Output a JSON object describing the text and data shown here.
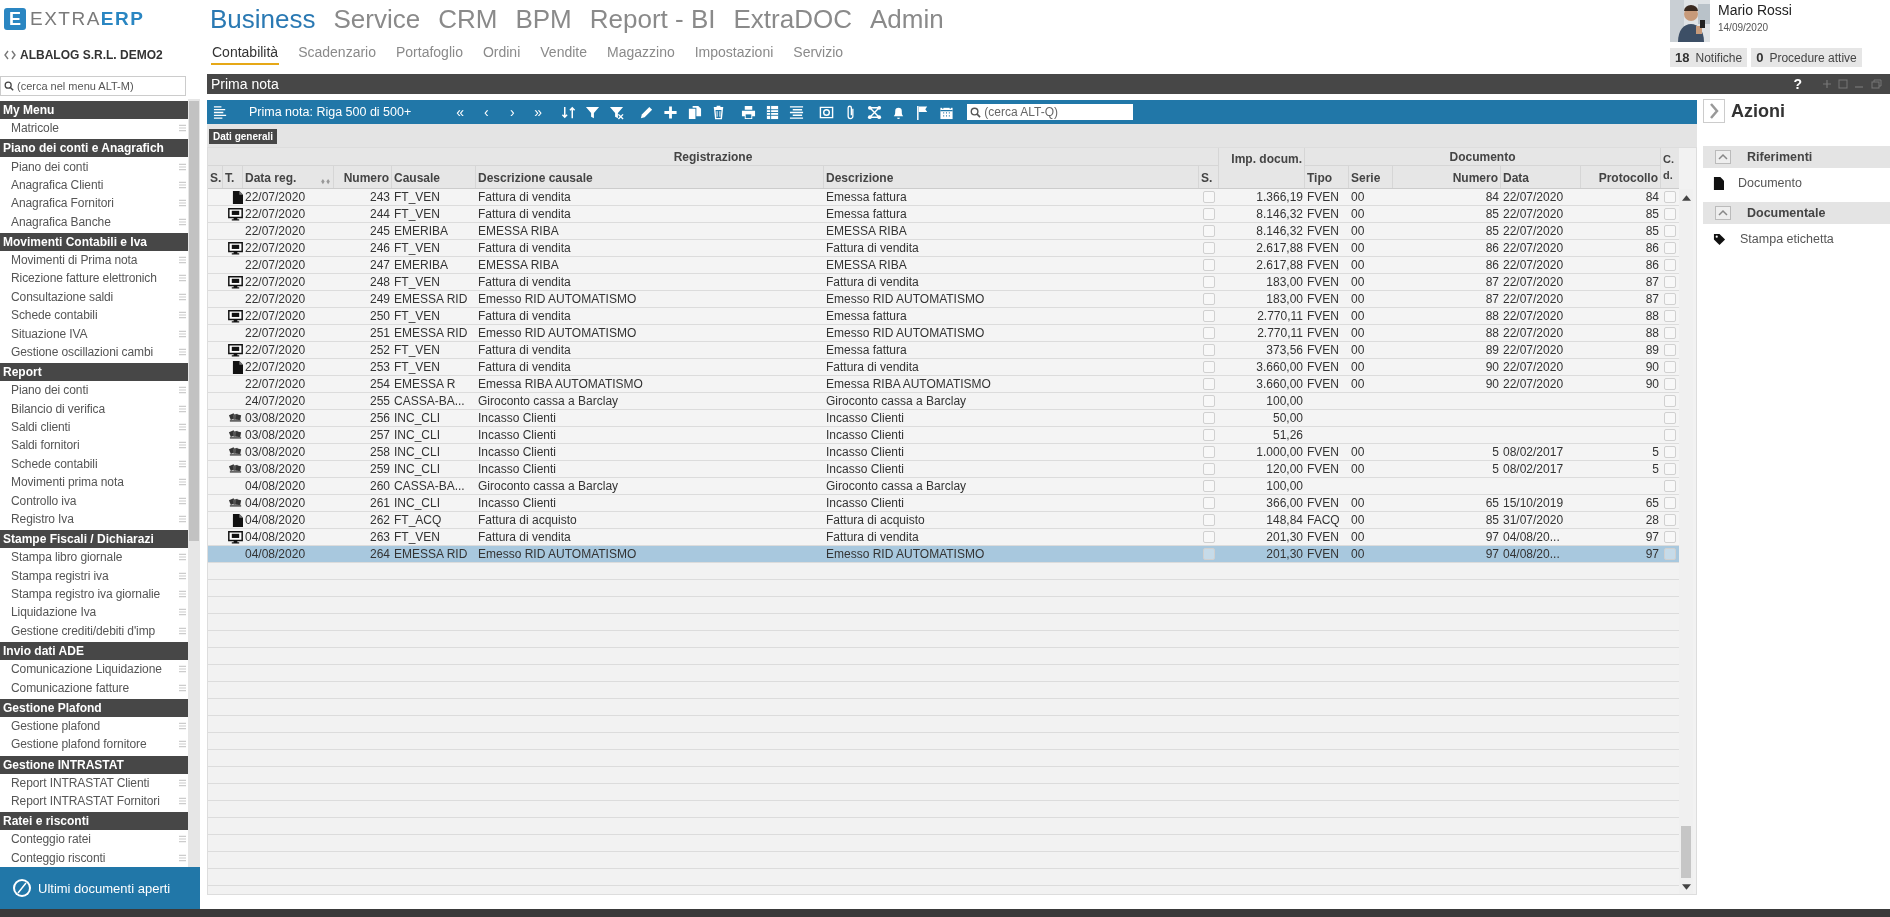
{
  "logo": {
    "badge": "E",
    "text": "EXTRA",
    "accent": "ERP"
  },
  "company": "ALBALOG S.R.L. DEMO2",
  "modules": [
    {
      "label": "Business",
      "selected": true
    },
    {
      "label": "Service",
      "selected": false
    },
    {
      "label": "CRM",
      "selected": false
    },
    {
      "label": "BPM",
      "selected": false
    },
    {
      "label": "Report - BI",
      "selected": false
    },
    {
      "label": "ExtraDOC",
      "selected": false
    },
    {
      "label": "Admin",
      "selected": false
    }
  ],
  "sections": [
    {
      "label": "Contabilità",
      "selected": true
    },
    {
      "label": "Scadenzario",
      "selected": false
    },
    {
      "label": "Portafoglio",
      "selected": false
    },
    {
      "label": "Ordini",
      "selected": false
    },
    {
      "label": "Vendite",
      "selected": false
    },
    {
      "label": "Magazzino",
      "selected": false
    },
    {
      "label": "Impostazioni",
      "selected": false
    },
    {
      "label": "Servizio",
      "selected": false
    }
  ],
  "user": {
    "name": "Mario Rossi",
    "date": "14/09/2020"
  },
  "counters": [
    {
      "count": "18",
      "label": "Notifiche"
    },
    {
      "count": "0",
      "label": "Procedure attive"
    }
  ],
  "menu_search": {
    "placeholder": "(cerca nel menu ALT-M)"
  },
  "menu": [
    {
      "title": "My Menu",
      "items": [
        "Matricole"
      ]
    },
    {
      "title": "Piano dei conti e Anagrafich",
      "items": [
        "Piano dei conti",
        "Anagrafica Clienti",
        "Anagrafica Fornitori",
        "Anagrafica Banche"
      ]
    },
    {
      "title": "Movimenti Contabili e Iva",
      "items": [
        "Movimenti di Prima nota",
        "Ricezione fatture elettronich",
        "Consultazione saldi",
        "Schede contabili",
        "Situazione IVA",
        "Gestione oscillazioni cambi"
      ]
    },
    {
      "title": "Report",
      "items": [
        "Piano dei conti",
        "Bilancio di verifica",
        "Saldi clienti",
        "Saldi fornitori",
        "Schede contabili",
        "Movimenti prima nota",
        "Controllo iva",
        "Registro Iva"
      ]
    },
    {
      "title": "Stampe Fiscali / Dichiarazi",
      "items": [
        "Stampa libro giornale",
        "Stampa registri iva",
        "Stampa registro iva giornalie",
        "Liquidazione Iva",
        "Gestione crediti/debiti d'imp"
      ]
    },
    {
      "title": "Invio dati ADE",
      "items": [
        "Comunicazione Liquidazione",
        "Comunicazione fatture"
      ]
    },
    {
      "title": "Gestione Plafond",
      "items": [
        "Gestione plafond",
        "Gestione plafond fornitore"
      ]
    },
    {
      "title": "Gestione INTRASTAT",
      "items": [
        "Report INTRASTAT Clienti",
        "Report INTRASTAT Fornitori"
      ]
    },
    {
      "title": "Ratei e risconti",
      "items": [
        "Conteggio ratei",
        "Conteggio risconti"
      ]
    }
  ],
  "recent_button": "Ultimi documenti aperti",
  "window": {
    "title": "Prima nota",
    "help": "?"
  },
  "toolbar": {
    "title": "Prima nota: Riga 500 di 500+",
    "nav": [
      "«",
      "‹",
      "›",
      "»"
    ],
    "search": {
      "placeholder": "(cerca ALT-Q)"
    }
  },
  "tabs": [
    {
      "label": "Dati generali",
      "selected": true
    }
  ],
  "table": {
    "header": [
      {
        "group": "Registrazione",
        "columns": [
          "S.",
          "T.",
          "Data reg.",
          "Numero",
          "Causale",
          "Descrizione causale",
          "Descrizione",
          "S."
        ]
      },
      {
        "column": "Imp. docum."
      },
      {
        "group": "Documento",
        "columns": [
          "Tipo",
          "Serie",
          "Numero",
          "Data",
          "Protocollo"
        ]
      },
      {
        "column": "C. d."
      }
    ],
    "rows": [
      {
        "kind": "document",
        "date": "22/07/2020",
        "number": "243",
        "causale": "FT_VEN",
        "causale_desc": "Fattura di vendita",
        "description": "Emessa fattura",
        "s_checked": false,
        "amount": "1.366,19",
        "type": "FVEN",
        "series": "00",
        "doc_number": "84",
        "doc_date": "22/07/2020",
        "protocol": "84",
        "cd_checked": false,
        "selected": false
      },
      {
        "kind": "monitor",
        "date": "22/07/2020",
        "number": "244",
        "causale": "FT_VEN",
        "causale_desc": "Fattura di vendita",
        "description": "Emessa fattura",
        "s_checked": false,
        "amount": "8.146,32",
        "type": "FVEN",
        "series": "00",
        "doc_number": "85",
        "doc_date": "22/07/2020",
        "protocol": "85",
        "cd_checked": false,
        "selected": false
      },
      {
        "date": "22/07/2020",
        "number": "245",
        "causale": "EMERIBA",
        "causale_desc": "EMESSA RIBA",
        "description": "EMESSA RIBA",
        "s_checked": false,
        "amount": "8.146,32",
        "type": "FVEN",
        "series": "00",
        "doc_number": "85",
        "doc_date": "22/07/2020",
        "protocol": "85",
        "cd_checked": false,
        "selected": false
      },
      {
        "kind": "monitor",
        "date": "22/07/2020",
        "number": "246",
        "causale": "FT_VEN",
        "causale_desc": "Fattura di vendita",
        "description": "Fattura di vendita",
        "s_checked": false,
        "amount": "2.617,88",
        "type": "FVEN",
        "series": "00",
        "doc_number": "86",
        "doc_date": "22/07/2020",
        "protocol": "86",
        "cd_checked": false,
        "selected": false
      },
      {
        "date": "22/07/2020",
        "number": "247",
        "causale": "EMERIBA",
        "causale_desc": "EMESSA RIBA",
        "description": "EMESSA RIBA",
        "s_checked": false,
        "amount": "2.617,88",
        "type": "FVEN",
        "series": "00",
        "doc_number": "86",
        "doc_date": "22/07/2020",
        "protocol": "86",
        "cd_checked": false,
        "selected": false
      },
      {
        "kind": "monitor",
        "date": "22/07/2020",
        "number": "248",
        "causale": "FT_VEN",
        "causale_desc": "Fattura di vendita",
        "description": "Fattura di vendita",
        "s_checked": false,
        "amount": "183,00",
        "type": "FVEN",
        "series": "00",
        "doc_number": "87",
        "doc_date": "22/07/2020",
        "protocol": "87",
        "cd_checked": false,
        "selected": false
      },
      {
        "date": "22/07/2020",
        "number": "249",
        "causale": "EMESSA RID",
        "causale_desc": "Emesso RID AUTOMATISMO",
        "description": "Emesso RID AUTOMATISMO",
        "s_checked": false,
        "amount": "183,00",
        "type": "FVEN",
        "series": "00",
        "doc_number": "87",
        "doc_date": "22/07/2020",
        "protocol": "87",
        "cd_checked": false,
        "selected": false
      },
      {
        "kind": "monitor",
        "date": "22/07/2020",
        "number": "250",
        "causale": "FT_VEN",
        "causale_desc": "Fattura di vendita",
        "description": "Emessa fattura",
        "s_checked": false,
        "amount": "2.770,11",
        "type": "FVEN",
        "series": "00",
        "doc_number": "88",
        "doc_date": "22/07/2020",
        "protocol": "88",
        "cd_checked": false,
        "selected": false
      },
      {
        "date": "22/07/2020",
        "number": "251",
        "causale": "EMESSA RID",
        "causale_desc": "Emesso RID AUTOMATISMO",
        "description": "Emesso RID AUTOMATISMO",
        "s_checked": false,
        "amount": "2.770,11",
        "type": "FVEN",
        "series": "00",
        "doc_number": "88",
        "doc_date": "22/07/2020",
        "protocol": "88",
        "cd_checked": false,
        "selected": false
      },
      {
        "kind": "monitor",
        "date": "22/07/2020",
        "number": "252",
        "causale": "FT_VEN",
        "causale_desc": "Fattura di vendita",
        "description": "Emessa fattura",
        "s_checked": false,
        "amount": "373,56",
        "type": "FVEN",
        "series": "00",
        "doc_number": "89",
        "doc_date": "22/07/2020",
        "protocol": "89",
        "cd_checked": false,
        "selected": false
      },
      {
        "kind": "document",
        "date": "22/07/2020",
        "number": "253",
        "causale": "FT_VEN",
        "causale_desc": "Fattura di vendita",
        "description": "Fattura di vendita",
        "s_checked": false,
        "amount": "3.660,00",
        "type": "FVEN",
        "series": "00",
        "doc_number": "90",
        "doc_date": "22/07/2020",
        "protocol": "90",
        "cd_checked": false,
        "selected": false
      },
      {
        "date": "22/07/2020",
        "number": "254",
        "causale": "EMESSA R",
        "causale_desc": "Emessa RIBA AUTOMATISMO",
        "description": "Emessa RIBA AUTOMATISMO",
        "s_checked": false,
        "amount": "3.660,00",
        "type": "FVEN",
        "series": "00",
        "doc_number": "90",
        "doc_date": "22/07/2020",
        "protocol": "90",
        "cd_checked": false,
        "selected": false
      },
      {
        "date": "24/07/2020",
        "number": "255",
        "causale": "CASSA-BA...",
        "causale_desc": "Giroconto cassa a Barclay",
        "description": "Giroconto cassa a Barclay",
        "s_checked": false,
        "amount": "100,00",
        "cd_checked": false,
        "selected": false
      },
      {
        "kind": "cards",
        "date": "03/08/2020",
        "number": "256",
        "causale": "INC_CLI",
        "causale_desc": "Incasso Clienti",
        "description": "Incasso Clienti",
        "s_checked": false,
        "amount": "50,00",
        "cd_checked": false,
        "selected": false
      },
      {
        "kind": "cards",
        "date": "03/08/2020",
        "number": "257",
        "causale": "INC_CLI",
        "causale_desc": "Incasso Clienti",
        "description": "Incasso Clienti",
        "s_checked": false,
        "amount": "51,26",
        "cd_checked": false,
        "selected": false
      },
      {
        "kind": "cards",
        "date": "03/08/2020",
        "number": "258",
        "causale": "INC_CLI",
        "causale_desc": "Incasso Clienti",
        "description": "Incasso Clienti",
        "s_checked": false,
        "amount": "1.000,00",
        "type": "FVEN",
        "series": "00",
        "doc_number": "5",
        "doc_date": "08/02/2017",
        "protocol": "5",
        "cd_checked": false,
        "selected": false
      },
      {
        "kind": "cards",
        "date": "03/08/2020",
        "number": "259",
        "causale": "INC_CLI",
        "causale_desc": "Incasso Clienti",
        "description": "Incasso Clienti",
        "s_checked": false,
        "amount": "120,00",
        "type": "FVEN",
        "series": "00",
        "doc_number": "5",
        "doc_date": "08/02/2017",
        "protocol": "5",
        "cd_checked": false,
        "selected": false
      },
      {
        "date": "04/08/2020",
        "number": "260",
        "causale": "CASSA-BA...",
        "causale_desc": "Giroconto cassa a Barclay",
        "description": "Giroconto cassa a Barclay",
        "s_checked": false,
        "amount": "100,00",
        "cd_checked": false,
        "selected": false
      },
      {
        "kind": "cards",
        "date": "04/08/2020",
        "number": "261",
        "causale": "INC_CLI",
        "causale_desc": "Incasso Clienti",
        "description": "Incasso Clienti",
        "s_checked": false,
        "amount": "366,00",
        "type": "FVEN",
        "series": "00",
        "doc_number": "65",
        "doc_date": "15/10/2019",
        "protocol": "65",
        "cd_checked": false,
        "selected": false
      },
      {
        "kind": "document",
        "date": "04/08/2020",
        "number": "262",
        "causale": "FT_ACQ",
        "causale_desc": "Fattura di acquisto",
        "description": "Fattura di acquisto",
        "s_checked": false,
        "amount": "148,84",
        "type": "FACQ",
        "series": "00",
        "doc_number": "85",
        "doc_date": "31/07/2020",
        "protocol": "28",
        "cd_checked": false,
        "selected": false
      },
      {
        "kind": "monitor",
        "date": "04/08/2020",
        "number": "263",
        "causale": "FT_VEN",
        "causale_desc": "Fattura di vendita",
        "description": "Fattura di vendita",
        "s_checked": false,
        "amount": "201,30",
        "type": "FVEN",
        "series": "00",
        "doc_number": "97",
        "doc_date": "04/08/20...",
        "protocol": "97",
        "cd_checked": false,
        "selected": false
      },
      {
        "date": "04/08/2020",
        "number": "264",
        "causale": "EMESSA RID",
        "causale_desc": "Emesso RID AUTOMATISMO",
        "description": "Emesso RID AUTOMATISMO",
        "s_checked": false,
        "amount": "201,30",
        "type": "FVEN",
        "series": "00",
        "doc_number": "97",
        "doc_date": "04/08/20...",
        "protocol": "97",
        "cd_checked": false,
        "selected": true
      }
    ]
  },
  "actions": {
    "title": "Azioni",
    "sections": [
      {
        "title": "Riferimenti",
        "expanded": true,
        "items": [
          {
            "label": "Documento",
            "kind": "document"
          }
        ]
      },
      {
        "title": "Documentale",
        "expanded": true,
        "items": [
          {
            "label": "Stampa etichetta",
            "kind": "tag"
          }
        ]
      }
    ]
  }
}
